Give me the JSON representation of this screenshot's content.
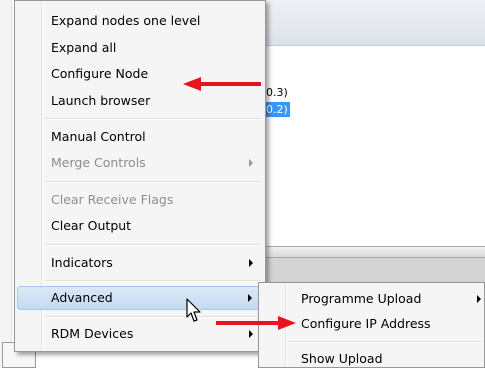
{
  "background": {
    "tree_nodes": [
      "0.3)",
      "0.2)"
    ]
  },
  "menu": {
    "items": [
      {
        "label": "Expand nodes one level"
      },
      {
        "label": "Expand all"
      },
      {
        "label": "Configure Node"
      },
      {
        "label": "Launch browser"
      },
      {
        "label": "Manual Control"
      },
      {
        "label": "Merge Controls"
      },
      {
        "label": "Clear Receive Flags"
      },
      {
        "label": "Clear Output"
      },
      {
        "label": "Indicators"
      },
      {
        "label": "Advanced"
      },
      {
        "label": "RDM Devices"
      }
    ]
  },
  "submenu": {
    "items": [
      {
        "label": "Programme Upload"
      },
      {
        "label": "Configure IP Address"
      },
      {
        "label": "Show Upload"
      }
    ]
  },
  "annotation_color": "#e8141b",
  "highlight_color": "#c4daf2",
  "selection_color": "#3399ff"
}
